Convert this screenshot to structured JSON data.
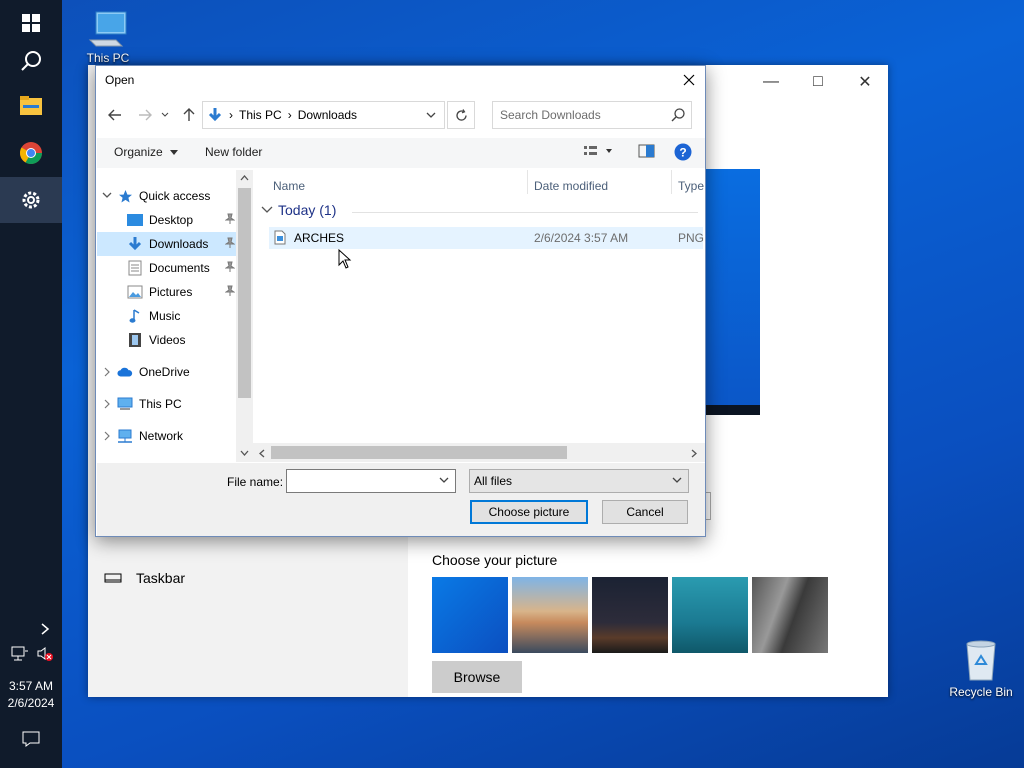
{
  "taskbar": {
    "icons": [
      "windows-start-icon",
      "search-icon",
      "file-explorer-icon",
      "chrome-icon",
      "settings-icon"
    ],
    "time": "3:57 AM",
    "date": "2/6/2024"
  },
  "desktop": {
    "this_pc_label": "This PC",
    "recycle_bin_label": "Recycle Bin"
  },
  "settings": {
    "taskbar_label": "Taskbar",
    "choose_picture_label": "Choose your picture",
    "browse_label": "Browse"
  },
  "dialog": {
    "title": "Open",
    "address": [
      "This PC",
      "Downloads"
    ],
    "search_placeholder": "Search Downloads",
    "organize_label": "Organize",
    "new_folder_label": "New folder",
    "nav": [
      {
        "label": "Quick access",
        "icon": "star-icon"
      },
      {
        "label": "Desktop",
        "icon": "desktop-folder-icon",
        "pinned": true
      },
      {
        "label": "Downloads",
        "icon": "downloads-folder-icon",
        "pinned": true,
        "selected": true
      },
      {
        "label": "Documents",
        "icon": "documents-folder-icon",
        "pinned": true
      },
      {
        "label": "Pictures",
        "icon": "pictures-folder-icon",
        "pinned": true
      },
      {
        "label": "Music",
        "icon": "music-icon"
      },
      {
        "label": "Videos",
        "icon": "videos-icon"
      },
      {
        "label": "OneDrive",
        "icon": "onedrive-icon"
      },
      {
        "label": "This PC",
        "icon": "pc-icon"
      },
      {
        "label": "Network",
        "icon": "network-icon"
      }
    ],
    "columns": {
      "name": "Name",
      "date": "Date modified",
      "type": "Type"
    },
    "group_label": "Today (1)",
    "files": [
      {
        "name": "ARCHES",
        "date": "2/6/2024 3:57 AM",
        "type": "PNG"
      }
    ],
    "file_name_label": "File name:",
    "file_name_value": "",
    "filter_label": "All files",
    "choose_button": "Choose picture",
    "cancel_button": "Cancel"
  }
}
